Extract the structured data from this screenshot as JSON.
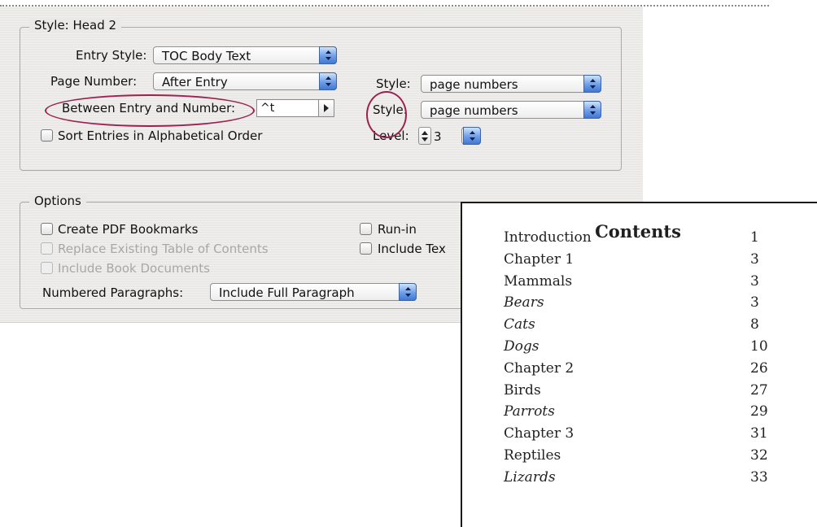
{
  "style_group": {
    "title": "Style: Head 2",
    "entry_style": {
      "label": "Entry Style:",
      "value": "TOC Body Text"
    },
    "page_number": {
      "label": "Page Number:",
      "value": "After Entry",
      "style_label": "Style:",
      "style_value": "page numbers"
    },
    "between": {
      "label": "Between Entry and Number:",
      "value": "^t",
      "style_label": "Style:",
      "style_value": "page numbers"
    },
    "sort_label": "Sort Entries in Alphabetical Order",
    "level": {
      "label": "Level:",
      "value": "3"
    }
  },
  "options_group": {
    "title": "Options",
    "create_pdf_bookmarks": "Create PDF Bookmarks",
    "replace_existing": "Replace Existing Table of Contents",
    "include_book_docs": "Include Book Documents",
    "run_in": "Run-in",
    "include_text": "Include Tex",
    "numbered_paragraphs": {
      "label": "Numbered Paragraphs:",
      "value": "Include Full Paragraph"
    }
  },
  "toc": {
    "title": "Contents",
    "entries": [
      {
        "text": "Introduction",
        "page": "1",
        "italic": false
      },
      {
        "text": "Chapter 1",
        "page": "3",
        "italic": false
      },
      {
        "text": "Mammals",
        "page": "3",
        "italic": false
      },
      {
        "text": "Bears",
        "page": "3",
        "italic": true
      },
      {
        "text": "Cats",
        "page": "8",
        "italic": true
      },
      {
        "text": "Dogs",
        "page": "10",
        "italic": true
      },
      {
        "text": "Chapter 2",
        "page": "26",
        "italic": false
      },
      {
        "text": "Birds",
        "page": "27",
        "italic": false
      },
      {
        "text": "Parrots",
        "page": "29",
        "italic": true
      },
      {
        "text": "Chapter 3",
        "page": "31",
        "italic": false
      },
      {
        "text": "Reptiles",
        "page": "32",
        "italic": false
      },
      {
        "text": "Lizards",
        "page": "33",
        "italic": true
      }
    ]
  },
  "colors": {
    "highlight": "#9b2250",
    "popup_accent": "#4a82dc"
  }
}
